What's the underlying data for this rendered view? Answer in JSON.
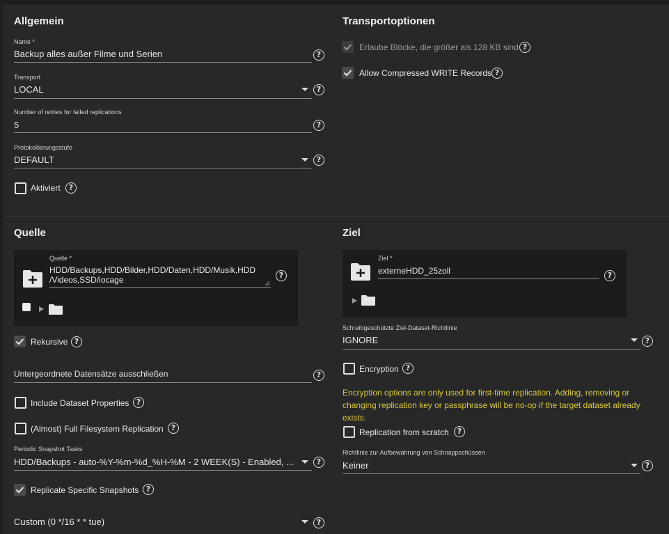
{
  "general": {
    "title": "Allgemein",
    "name_label": "Name *",
    "name_value": "Backup alles außer Filme und Serien",
    "transport_label": "Transport",
    "transport_value": "LOCAL",
    "retries_label": "Number of retries for failed replications",
    "retries_value": "5",
    "log_label": "Protokollierungsstufe",
    "log_value": "DEFAULT",
    "enabled_label": "Aktiviert"
  },
  "transport_options": {
    "title": "Transportoptionen",
    "large_blocks_label": "Erlaube Blöcke, die größer als 128 KB sind",
    "compressed_label": "Allow Compressed WRITE Records"
  },
  "source": {
    "title": "Quelle",
    "field_label": "Quelle *",
    "field_value_line1": "HDD/Backups,HDD/Bilder,HDD/Daten,HDD/Musik,HDD",
    "field_value_line2": "/Videos,SSD/iocage",
    "recursive_label": "Rekursive",
    "exclude_label": "Untergeordnete Datensätze ausschließen",
    "dataset_props_label": "Include Dataset Properties",
    "full_fs_label": "(Almost) Full Filesystem Replication",
    "periodic_label": "Periodic Snapshot Tasks",
    "periodic_value": "HDD/Backups - auto-%Y-%m-%d_%H-%M - 2 WEEK(S) - Enabled, ...",
    "replicate_specific_label": "Replicate Specific Snapshots",
    "schedule_value": "Custom (0 */16 * * tue)"
  },
  "target": {
    "title": "Ziel",
    "field_label": "Ziel *",
    "field_value": "externeHDD_25zoll",
    "readonly_label": "Schreibgeschützte Ziel-Dataset-Richtlinie",
    "readonly_value": "IGNORE",
    "encryption_label": "Encryption",
    "encryption_warning": "Encryption options are only used for first-time replication. Adding, removing or changing replication key or passphrase will be no-op if the target dataset already exists.",
    "scratch_label": "Replication from scratch",
    "retention_label": "Richtlinie zur Aufbewahrung von Schnappschüssen",
    "retention_value": "Keiner"
  },
  "icons": {
    "help": "?",
    "checkmark": "check-icon",
    "folder": "folder-icon",
    "add_folder": "folder-plus-icon",
    "expand": "triangle-right-icon",
    "dropdown": "caret-down-icon"
  },
  "colors": {
    "background": "#282828",
    "warning": "#d8c83a"
  }
}
